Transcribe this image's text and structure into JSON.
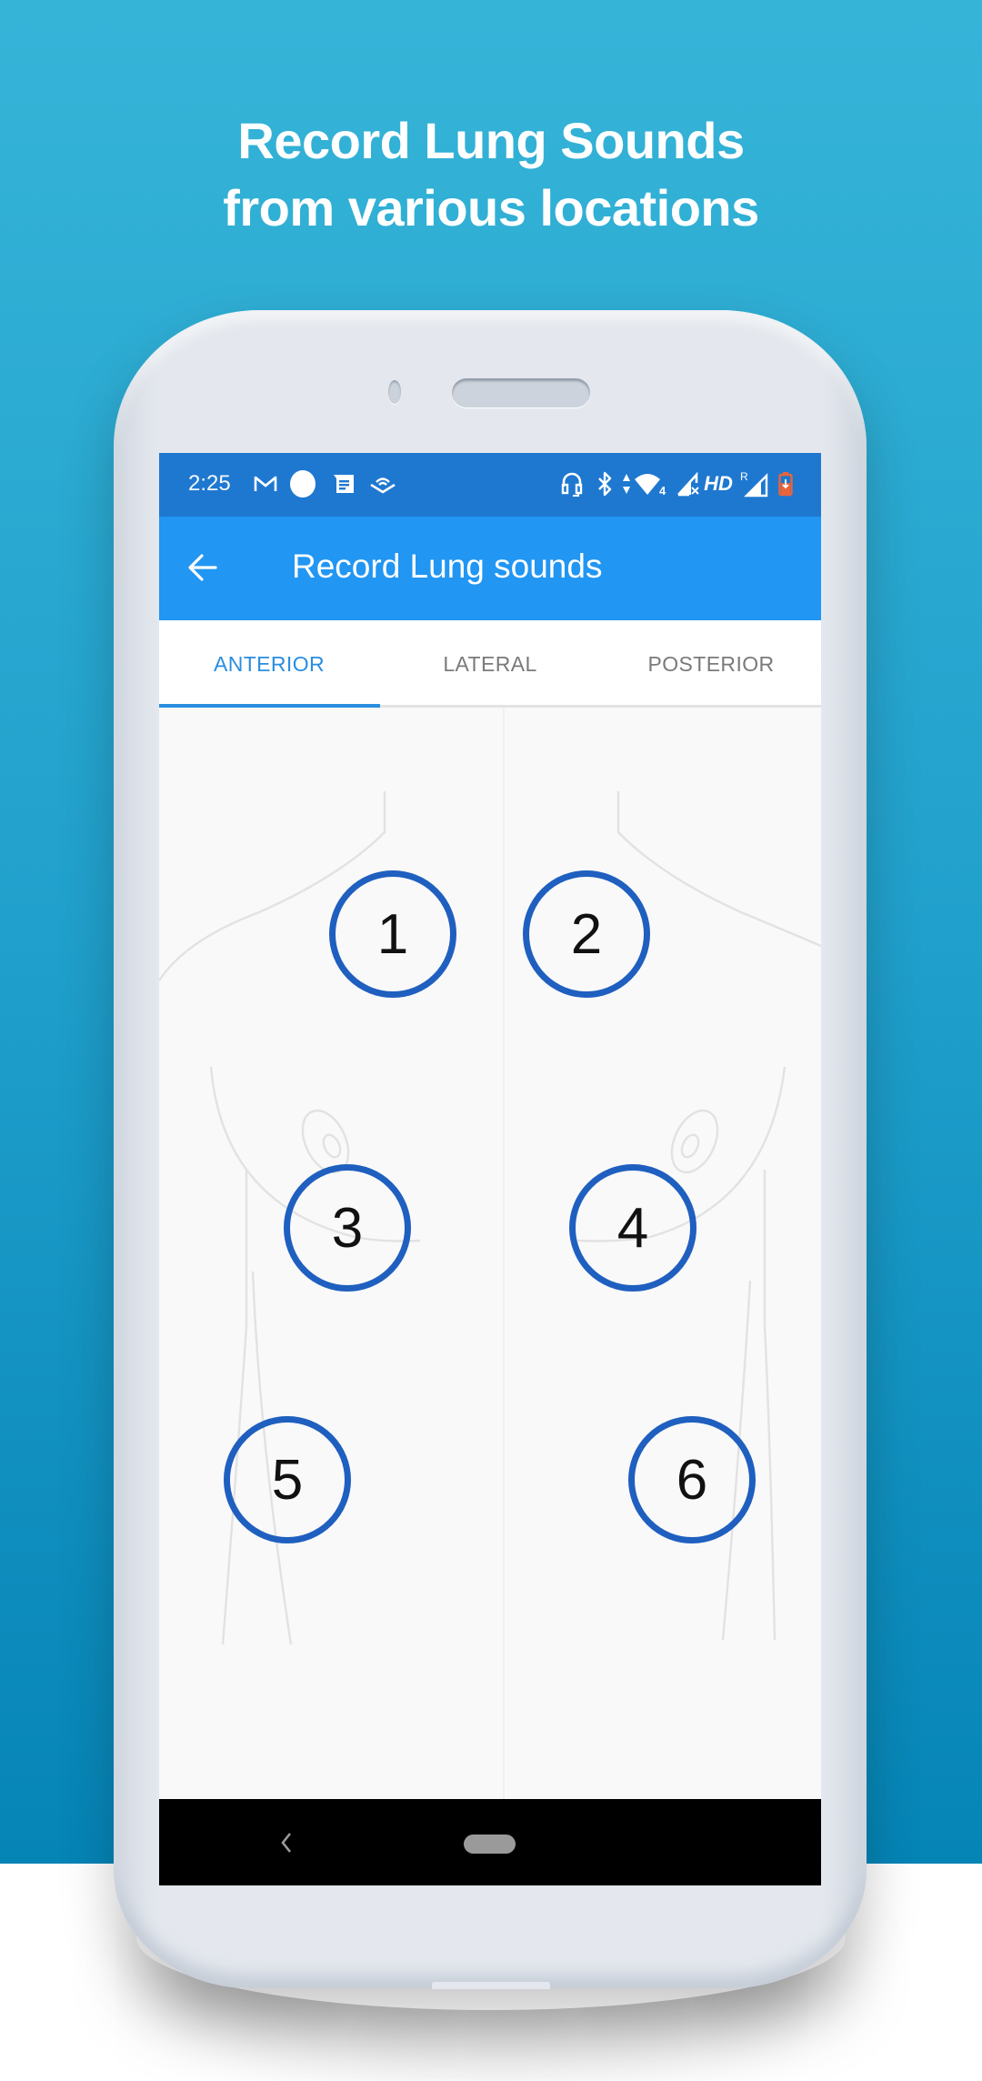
{
  "promo": {
    "headline_line1": "Record Lung Sounds",
    "headline_line2": "from various locations",
    "background_top": "#36b4d8",
    "background_bottom": "#0584b6"
  },
  "status_bar": {
    "time": "2:25",
    "left_icons": [
      "gmail-icon",
      "circle-notification-icon",
      "messages-icon",
      "audible-icon"
    ],
    "right_icons": [
      "headset-icon",
      "bluetooth-icon",
      "wifi-data-icon",
      "signal-no-sim-icon",
      "hd-icon",
      "roaming-signal-icon",
      "battery-charging-icon"
    ],
    "wifi_badge": "4",
    "hd_label": "HD",
    "roaming_label": "R",
    "color": "#1e78d0"
  },
  "app_bar": {
    "title": "Record Lung sounds",
    "back_icon": "arrow-left-icon",
    "color": "#2196f3"
  },
  "tabs": [
    {
      "label": "ANTERIOR",
      "active": true
    },
    {
      "label": "LATERAL",
      "active": false
    },
    {
      "label": "POSTERIOR",
      "active": false
    }
  ],
  "accent_color": "#2a8ee0",
  "auscultation_points": [
    {
      "label": "1"
    },
    {
      "label": "2"
    },
    {
      "label": "3"
    },
    {
      "label": "4"
    },
    {
      "label": "5"
    },
    {
      "label": "6"
    }
  ],
  "point_ring_color": "#1f5fbf",
  "nav_bar": {
    "back_icon": "nav-back-icon",
    "home_icon": "nav-home-pill-icon"
  }
}
